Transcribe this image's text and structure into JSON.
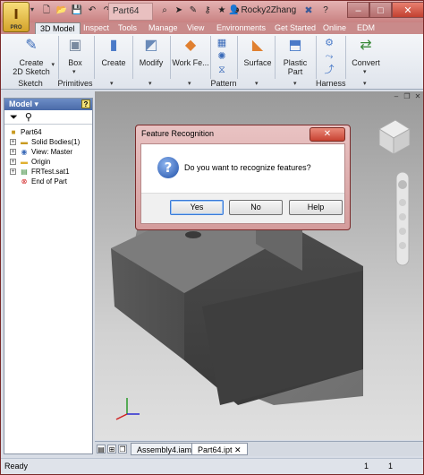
{
  "app": {
    "logo_letter": "I",
    "pro_badge": "PRO",
    "document_title": "Part64",
    "user_name": "Rocky2Zhang",
    "help_symbol": "?",
    "window_controls": {
      "minimize": "–",
      "maximize": "□",
      "close": "✕"
    }
  },
  "menu_tabs": [
    "3D Model",
    "Inspect",
    "Tools",
    "Manage",
    "View",
    "Environments",
    "Get Started",
    "Online",
    "EDM"
  ],
  "active_tab": "3D Model",
  "ribbon": {
    "buttons": {
      "create_sketch": "Create\n2D Sketch",
      "create_sketch_line1": "Create",
      "create_sketch_line2": "2D Sketch",
      "box": "Box",
      "create": "Create",
      "modify": "Modify",
      "work_features": "Work Fe...",
      "surface": "Surface",
      "plastic_part": "Plastic Part",
      "convert": "Convert"
    },
    "groups": {
      "sketch": "Sketch",
      "primitives": "Primitives",
      "pattern": "Pattern",
      "harness": "Harness"
    }
  },
  "browser": {
    "title": "Model",
    "help": "?",
    "items": [
      {
        "label": "Part64",
        "expandable": false
      },
      {
        "label": "Solid Bodies(1)",
        "expandable": true
      },
      {
        "label": "View: Master",
        "expandable": true
      },
      {
        "label": "Origin",
        "expandable": true
      },
      {
        "label": "FRTest.sat1",
        "expandable": true
      },
      {
        "label": "End of Part",
        "expandable": false
      }
    ]
  },
  "doc_tabs": [
    "Assembly4.iam",
    "Part64.ipt"
  ],
  "active_doc_tab": "Part64.ipt",
  "status": {
    "text": "Ready",
    "count1": "1",
    "count2": "1"
  },
  "dialog": {
    "title": "Feature Recognition",
    "message": "Do you want to recognize features?",
    "buttons": {
      "yes": "Yes",
      "no": "No",
      "help": "Help"
    },
    "close": "✕"
  },
  "colors": {
    "titlebar": "#d49c9c",
    "browser_header": "#4a6aa8",
    "viewport_top": "#9a9a9a",
    "viewport_bottom": "#e0e0e0",
    "dialog_close": "#c74232"
  }
}
